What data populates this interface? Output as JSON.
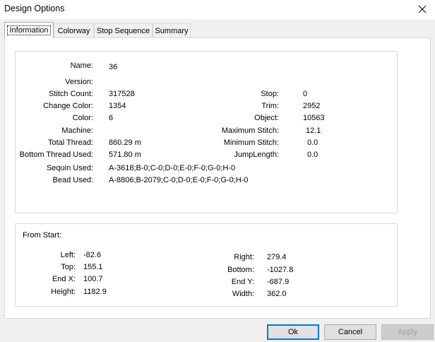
{
  "window": {
    "title": "Design Options"
  },
  "tabs": [
    "Information",
    "Colorway",
    "Stop Sequence",
    "Summary"
  ],
  "info_left": [
    {
      "label": "Name:",
      "value": "36"
    },
    {
      "label": "Version:",
      "value": ""
    },
    {
      "label": "Stitch Count:",
      "value": "317528"
    },
    {
      "label": "Change Color:",
      "value": "1354"
    },
    {
      "label": "Color:",
      "value": "6"
    },
    {
      "label": "Machine:",
      "value": ""
    },
    {
      "label": "Total Thread:",
      "value": "860.29 m"
    },
    {
      "label": "Bottom Thread Used:",
      "value": "571.80 m"
    },
    {
      "label": "Sequin Used:",
      "value": "A-3618;B-0;C-0;D-0;E-0;F-0;G-0;H-0"
    },
    {
      "label": "Bead Used:",
      "value": "A-8806;B-2079;C-0;D-0;E-0;F-0;G-0;H-0"
    }
  ],
  "info_right": [
    {
      "label": "Stop:",
      "value": "0"
    },
    {
      "label": "Trim:",
      "value": "2952"
    },
    {
      "label": "Object:",
      "value": "10563"
    },
    {
      "label": "Maximum Stitch:",
      "value": "12.1"
    },
    {
      "label": "Minimum Stitch:",
      "value": "0.0"
    },
    {
      "label": "JumpLength:",
      "value": "0.0"
    }
  ],
  "from_start": {
    "title": "From Start:",
    "left": [
      {
        "label": "Left:",
        "value": "-82.6"
      },
      {
        "label": "Top:",
        "value": "155.1"
      },
      {
        "label": "End X:",
        "value": "100.7"
      },
      {
        "label": "Height:",
        "value": "1182.9"
      }
    ],
    "right": [
      {
        "label": "Right:",
        "value": "279.4"
      },
      {
        "label": "Bottom:",
        "value": "-1027.8"
      },
      {
        "label": "End Y:",
        "value": "-687.9"
      },
      {
        "label": "Width:",
        "value": "362.0"
      }
    ]
  },
  "buttons": {
    "ok": "Ok",
    "cancel": "Cancel",
    "apply": "Apply"
  }
}
